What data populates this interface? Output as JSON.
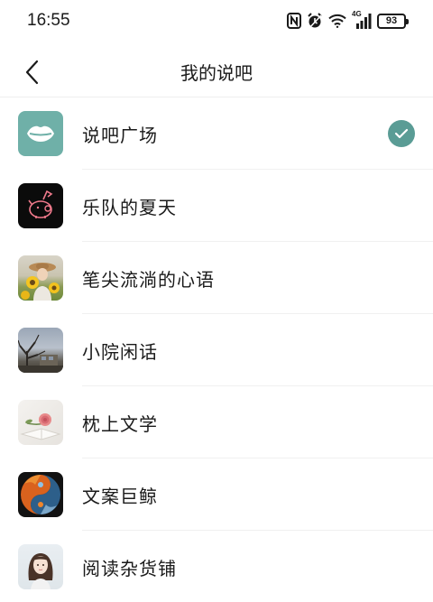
{
  "status_bar": {
    "time": "16:55",
    "signal_label": "4G",
    "battery": "93",
    "icons": [
      "nfc-icon",
      "alarm-icon",
      "wifi-icon",
      "cellular-signal-icon",
      "battery-icon"
    ]
  },
  "header": {
    "back_icon": "chevron-left-icon",
    "title": "我的说吧"
  },
  "colors": {
    "accent": "#5a9c95",
    "lips_bg": "#6fb0a8",
    "text": "#1a1a1a",
    "divider": "#f0f0f0"
  },
  "items": [
    {
      "label": "说吧广场",
      "icon": "lips-logo-icon",
      "selected": true
    },
    {
      "label": "乐队的夏天",
      "icon": "band-pig-logo-icon",
      "selected": false
    },
    {
      "label": "笔尖流淌的心语",
      "icon": "sunflower-girl-avatar",
      "selected": false
    },
    {
      "label": "小院闲话",
      "icon": "courtyard-tree-avatar",
      "selected": false
    },
    {
      "label": "枕上文学",
      "icon": "rose-book-avatar",
      "selected": false
    },
    {
      "label": "文案巨鲸",
      "icon": "yin-yang-fire-ice-avatar",
      "selected": false
    },
    {
      "label": "阅读杂货铺",
      "icon": "anime-girl-avatar",
      "selected": false
    }
  ]
}
